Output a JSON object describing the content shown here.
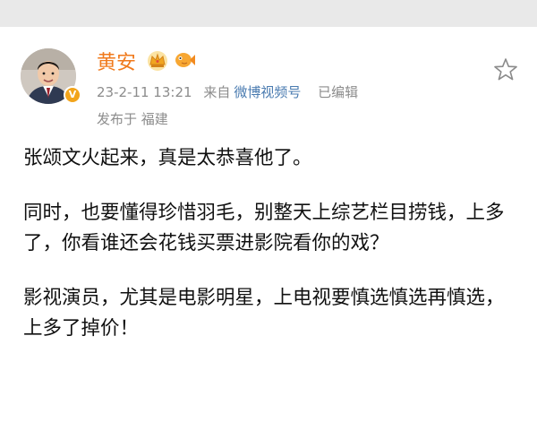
{
  "post": {
    "author": "黄安",
    "avatar_verified_mark": "V",
    "timestamp": "23-2-11 13:21",
    "source_prefix": "来自",
    "source": "微博视频号",
    "edited": "已编辑",
    "location": "发布于 福建",
    "paragraphs": [
      "张颂文火起来，真是太恭喜他了。",
      "同时，也要懂得珍惜羽毛，别整天上综艺栏目捞钱，上多了，你看谁还会花钱买票进影院看你的戏？",
      "影视演员，尤其是电影明星，上电视要慎选慎选再慎选，上多了掉价！"
    ]
  },
  "icons": {
    "avatar": "avatar-photo",
    "verified": "verified-badge-icon",
    "badge1": "crown-icon",
    "badge2": "fish-icon",
    "favorite": "star-icon"
  },
  "colors": {
    "author": "#f07a1c",
    "meta": "#8c8c8c",
    "source_link": "#4a7bb0",
    "verified": "#f2a41b"
  }
}
